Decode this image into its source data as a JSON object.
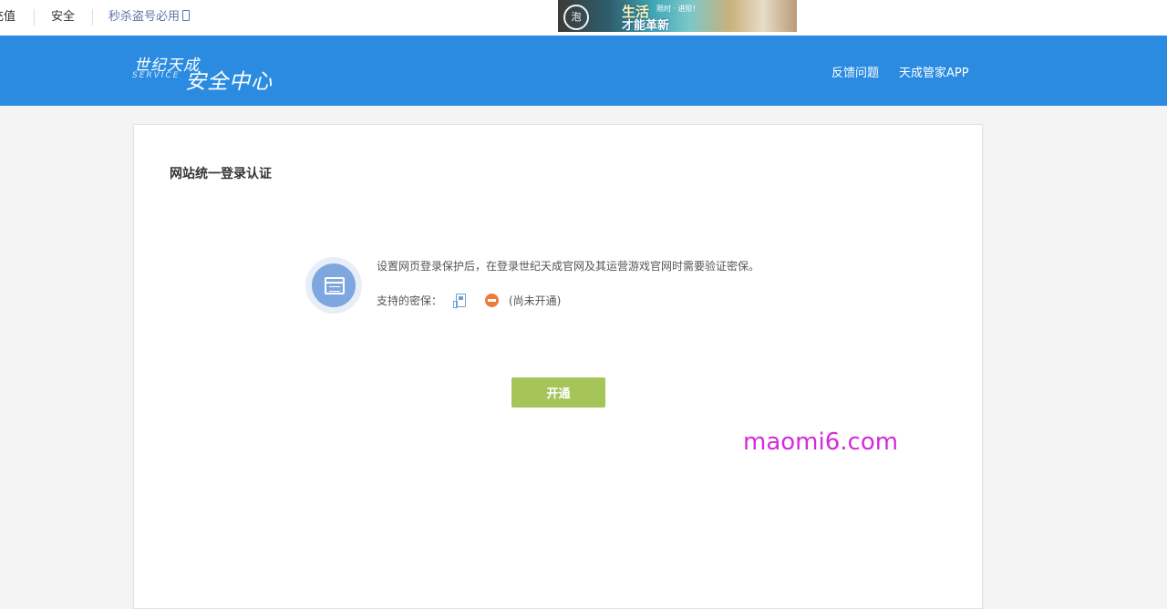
{
  "topbar": {
    "links": [
      "充值",
      "安全"
    ],
    "promo_label": "秒杀盗号必用"
  },
  "banner": {
    "seal_text": "泡",
    "line1": "生活",
    "badge": "限时 · 进阶！",
    "line2": "才能革新"
  },
  "header": {
    "logo_line1": "世纪天成",
    "logo_en": "SERVICE",
    "logo_line2": "安全中心",
    "nav": [
      "反馈问题",
      "天成管家APP"
    ]
  },
  "main": {
    "title": "网站统一登录认证",
    "description": "设置网页登录保护后，在登录世纪天成官网及其运营游戏官网时需要验证密保。",
    "support_label": "支持的密保：",
    "status": "(尚未开通)",
    "open_button": "开通"
  },
  "watermark": "maomi6.com",
  "colors": {
    "header_bg": "#2a8be0",
    "button_bg": "#a5c45a",
    "status_icon": "#f07a3a",
    "watermark": "#d52ad8"
  },
  "icons": [
    "phone-icon",
    "browser-window-icon",
    "mobile-token-icon",
    "not-enabled-icon"
  ]
}
